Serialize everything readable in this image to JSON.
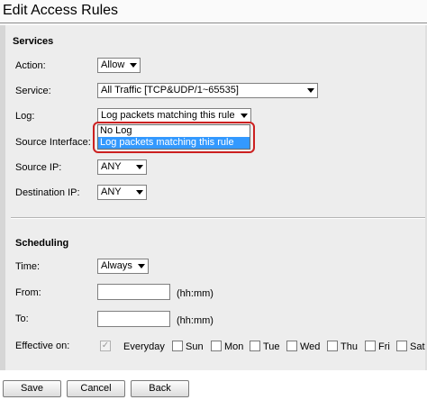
{
  "window": {
    "title": "Edit Access Rules"
  },
  "services": {
    "heading": "Services",
    "action": {
      "label": "Action:",
      "value": "Allow"
    },
    "service": {
      "label": "Service:",
      "value": "All Traffic [TCP&UDP/1~65535]"
    },
    "log": {
      "label": "Log:",
      "value": "Log packets matching this rule",
      "options": [
        "No Log",
        "Log packets matching this rule"
      ],
      "selected_index": 1
    },
    "source_interface": {
      "label": "Source Interface:"
    },
    "source_ip": {
      "label": "Source IP:",
      "value": "ANY"
    },
    "destination_ip": {
      "label": "Destination IP:",
      "value": "ANY"
    }
  },
  "scheduling": {
    "heading": "Scheduling",
    "time": {
      "label": "Time:",
      "value": "Always"
    },
    "from": {
      "label": "From:",
      "value": "",
      "unit": "(hh:mm)"
    },
    "to": {
      "label": "To:",
      "value": "",
      "unit": "(hh:mm)"
    },
    "effective_on": {
      "label": "Effective on:",
      "days": [
        {
          "label": "Everyday",
          "checked": true,
          "disabled": true
        },
        {
          "label": "Sun",
          "checked": false
        },
        {
          "label": "Mon",
          "checked": false
        },
        {
          "label": "Tue",
          "checked": false
        },
        {
          "label": "Wed",
          "checked": false
        },
        {
          "label": "Thu",
          "checked": false
        },
        {
          "label": "Fri",
          "checked": false
        },
        {
          "label": "Sat",
          "checked": false
        }
      ]
    }
  },
  "buttons": {
    "save": "Save",
    "cancel": "Cancel",
    "back": "Back"
  },
  "colors": {
    "highlight": "#cc2020",
    "selection": "#3399ff",
    "panel": "#ededed"
  }
}
